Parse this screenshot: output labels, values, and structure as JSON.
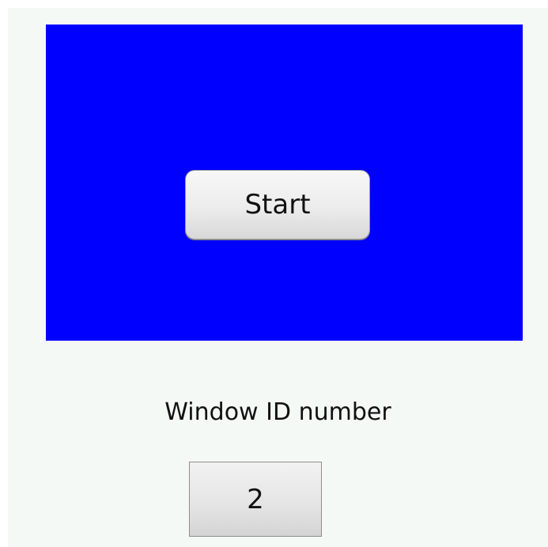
{
  "panel": {
    "background_color": "#0000ff",
    "start_button": {
      "label": "Start"
    }
  },
  "window_id": {
    "label": "Window ID number",
    "value": "2"
  }
}
